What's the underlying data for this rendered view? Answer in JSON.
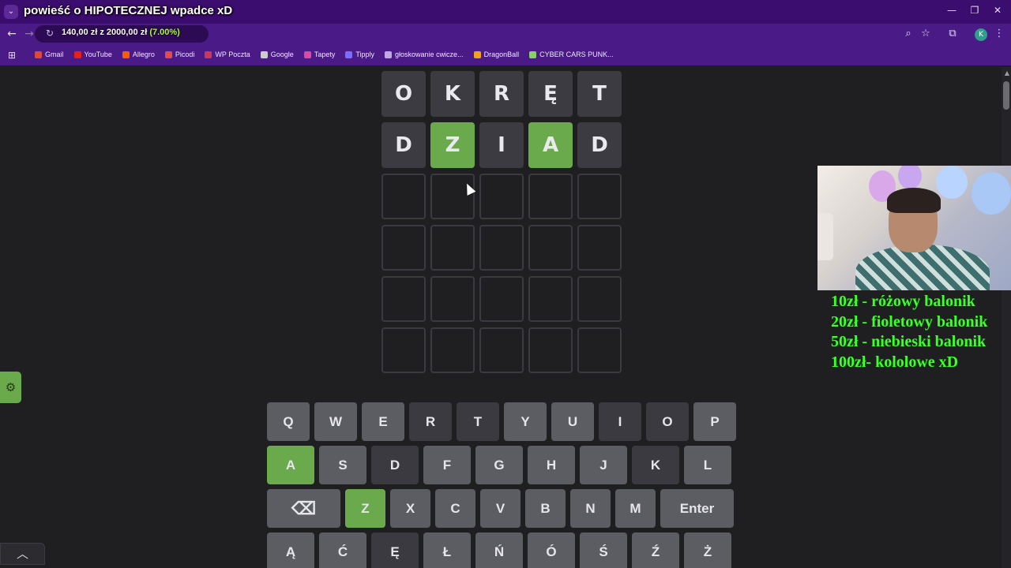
{
  "browser": {
    "overlay_title": "powieść o HIPOTECZNEJ wpadce xD",
    "donation_goal": {
      "text": "140,00 zł z 2000,00 zł",
      "percent_text": "(7.00%)",
      "progress": 0.07
    },
    "bookmarks": [
      {
        "label": "Gmail",
        "color": "#d94a3d"
      },
      {
        "label": "YouTube",
        "color": "#e62117"
      },
      {
        "label": "Allegro",
        "color": "#ff5a00"
      },
      {
        "label": "Picodi",
        "color": "#e04b4b"
      },
      {
        "label": "WP Poczta",
        "color": "#c9385a"
      },
      {
        "label": "Google",
        "color": "#cccccc"
      },
      {
        "label": "Tapety",
        "color": "#d94aa0"
      },
      {
        "label": "Tipply",
        "color": "#7a6cff"
      },
      {
        "label": "głoskowanie cwicze...",
        "color": "#c0a8e0"
      },
      {
        "label": "DragonBall",
        "color": "#f2a020"
      },
      {
        "label": "CYBER CARS PUNK...",
        "color": "#8ad06a"
      }
    ],
    "profile_initial": "K"
  },
  "game": {
    "board": [
      [
        {
          "letter": "O",
          "state": "absent"
        },
        {
          "letter": "K",
          "state": "absent"
        },
        {
          "letter": "R",
          "state": "absent"
        },
        {
          "letter": "Ę",
          "state": "absent"
        },
        {
          "letter": "T",
          "state": "absent"
        }
      ],
      [
        {
          "letter": "D",
          "state": "absent"
        },
        {
          "letter": "Z",
          "state": "correct"
        },
        {
          "letter": "I",
          "state": "absent"
        },
        {
          "letter": "A",
          "state": "correct"
        },
        {
          "letter": "D",
          "state": "absent"
        }
      ],
      [
        {
          "letter": "",
          "state": "empty"
        },
        {
          "letter": "",
          "state": "empty"
        },
        {
          "letter": "",
          "state": "empty"
        },
        {
          "letter": "",
          "state": "empty"
        },
        {
          "letter": "",
          "state": "empty"
        }
      ],
      [
        {
          "letter": "",
          "state": "empty"
        },
        {
          "letter": "",
          "state": "empty"
        },
        {
          "letter": "",
          "state": "empty"
        },
        {
          "letter": "",
          "state": "empty"
        },
        {
          "letter": "",
          "state": "empty"
        }
      ],
      [
        {
          "letter": "",
          "state": "empty"
        },
        {
          "letter": "",
          "state": "empty"
        },
        {
          "letter": "",
          "state": "empty"
        },
        {
          "letter": "",
          "state": "empty"
        },
        {
          "letter": "",
          "state": "empty"
        }
      ],
      [
        {
          "letter": "",
          "state": "empty"
        },
        {
          "letter": "",
          "state": "empty"
        },
        {
          "letter": "",
          "state": "empty"
        },
        {
          "letter": "",
          "state": "empty"
        },
        {
          "letter": "",
          "state": "empty"
        }
      ]
    ],
    "keyboard": [
      [
        {
          "label": "Q",
          "state": "unused"
        },
        {
          "label": "W",
          "state": "unused"
        },
        {
          "label": "E",
          "state": "unused"
        },
        {
          "label": "R",
          "state": "absent"
        },
        {
          "label": "T",
          "state": "absent"
        },
        {
          "label": "Y",
          "state": "unused"
        },
        {
          "label": "U",
          "state": "unused"
        },
        {
          "label": "I",
          "state": "absent"
        },
        {
          "label": "O",
          "state": "absent"
        },
        {
          "label": "P",
          "state": "unused"
        }
      ],
      [
        {
          "label": "A",
          "state": "correct"
        },
        {
          "label": "S",
          "state": "unused"
        },
        {
          "label": "D",
          "state": "absent"
        },
        {
          "label": "F",
          "state": "unused"
        },
        {
          "label": "G",
          "state": "unused"
        },
        {
          "label": "H",
          "state": "unused"
        },
        {
          "label": "J",
          "state": "unused"
        },
        {
          "label": "K",
          "state": "absent"
        },
        {
          "label": "L",
          "state": "unused"
        }
      ],
      [
        {
          "label": "⌫",
          "state": "unused",
          "wide": true,
          "icon": "backspace-icon"
        },
        {
          "label": "Z",
          "state": "correct"
        },
        {
          "label": "X",
          "state": "unused"
        },
        {
          "label": "C",
          "state": "unused"
        },
        {
          "label": "V",
          "state": "unused"
        },
        {
          "label": "B",
          "state": "unused"
        },
        {
          "label": "N",
          "state": "unused"
        },
        {
          "label": "M",
          "state": "unused"
        },
        {
          "label": "Enter",
          "state": "unused",
          "wide": true
        }
      ],
      [
        {
          "label": "Ą",
          "state": "unused"
        },
        {
          "label": "Ć",
          "state": "unused"
        },
        {
          "label": "Ę",
          "state": "absent"
        },
        {
          "label": "Ł",
          "state": "unused"
        },
        {
          "label": "Ń",
          "state": "unused"
        },
        {
          "label": "Ó",
          "state": "unused"
        },
        {
          "label": "Ś",
          "state": "unused"
        },
        {
          "label": "Ź",
          "state": "unused"
        },
        {
          "label": "Ż",
          "state": "unused"
        }
      ]
    ],
    "colors": {
      "correct": "#6aaa4c",
      "absent": "#3a3a40",
      "unused": "#5c5c63",
      "background": "#1f1f22"
    }
  },
  "overlay": {
    "donation_tiers": [
      "10zł - różowy balonik",
      "20zł - fioletowy balonik",
      "50zł - niebieski balonik",
      "100zł- kololowe xD"
    ],
    "text_color": "#3dff2a"
  }
}
